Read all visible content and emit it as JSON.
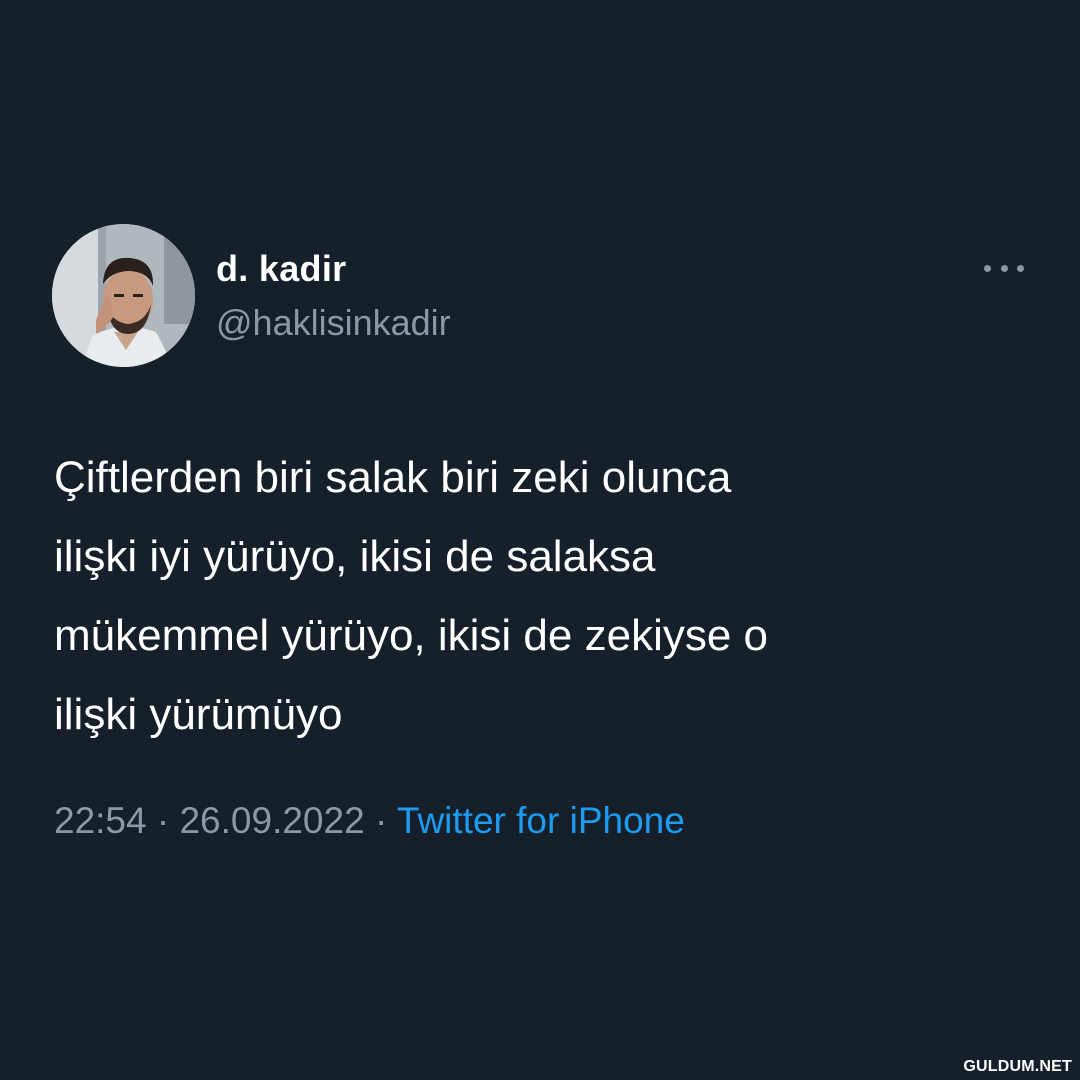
{
  "tweet": {
    "display_name": "d. kadir",
    "handle": "@haklisinkadir",
    "avatar_icon": "user-profile-photo",
    "more_icon": "more-options-icon",
    "text_lines": [
      "Çiftlerden biri salak biri zeki olunca",
      "ilişki iyi yürüyo, ikisi de salaksa",
      "mükemmel yürüyo, ikisi de zekiyse o",
      "ilişki yürümüyo"
    ],
    "time": "22:54",
    "separator": "·",
    "date": "26.09.2022",
    "source": "Twitter for iPhone"
  },
  "watermark": "GULDUM.NET",
  "colors": {
    "background": "#15202b",
    "text": "#ffffff",
    "secondary": "#8b98a5",
    "link": "#1d9bf0"
  }
}
